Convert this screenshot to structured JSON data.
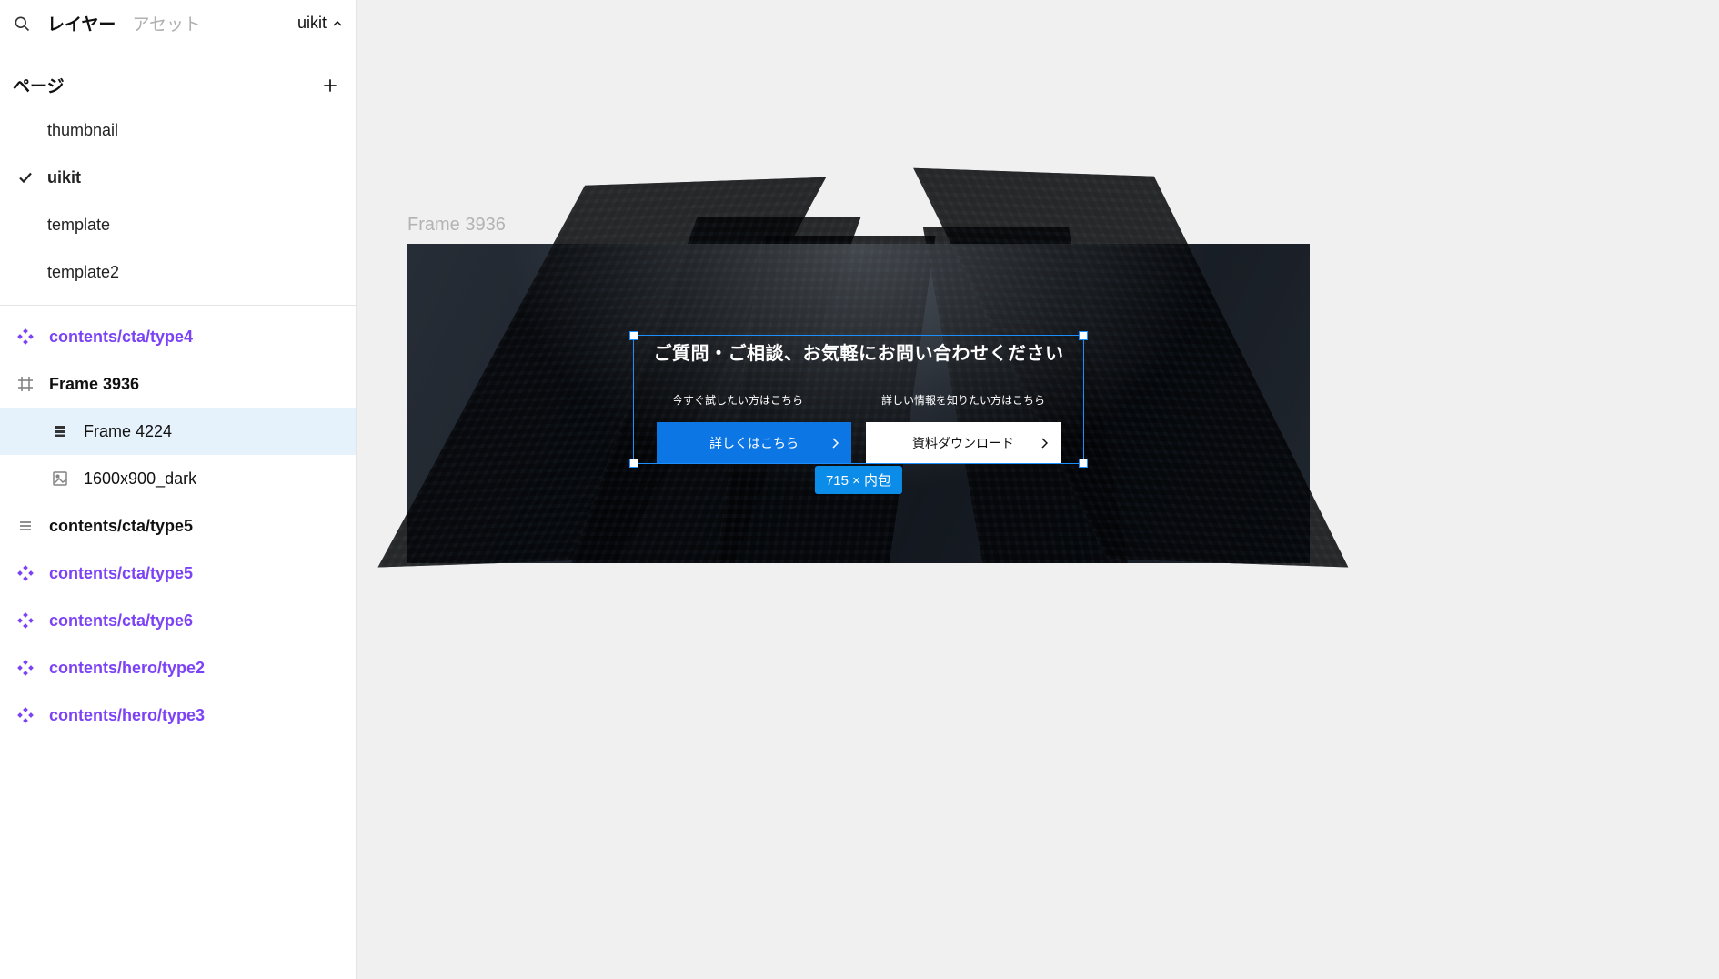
{
  "tabs": {
    "layers": "レイヤー",
    "assets": "アセット"
  },
  "project": {
    "name": "uikit"
  },
  "pagesSection": {
    "title": "ページ"
  },
  "pages": [
    {
      "name": "thumbnail",
      "current": false
    },
    {
      "name": "uikit",
      "current": true
    },
    {
      "name": "template",
      "current": false
    },
    {
      "name": "template2",
      "current": false
    }
  ],
  "layers": [
    {
      "icon": "component",
      "label": "contents/cta/type4",
      "style": "component",
      "indent": 0
    },
    {
      "icon": "frame",
      "label": "Frame 3936",
      "style": "bold",
      "indent": 0
    },
    {
      "icon": "vstack",
      "label": "Frame 4224",
      "style": "normal",
      "indent": 1,
      "selected": true
    },
    {
      "icon": "image",
      "label": "1600x900_dark",
      "style": "normal",
      "indent": 1
    },
    {
      "icon": "hstack",
      "label": "contents/cta/type5",
      "style": "bold",
      "indent": 0
    },
    {
      "icon": "component",
      "label": "contents/cta/type5",
      "style": "component",
      "indent": 0
    },
    {
      "icon": "component",
      "label": "contents/cta/type6",
      "style": "component",
      "indent": 0
    },
    {
      "icon": "component",
      "label": "contents/hero/type2",
      "style": "component",
      "indent": 0
    },
    {
      "icon": "component",
      "label": "contents/hero/type3",
      "style": "component",
      "indent": 0
    }
  ],
  "canvas": {
    "frameLabel": "Frame 3936",
    "cta": {
      "heading": "ご質問・ご相談、お気軽にお問い合わせください",
      "subLeft": "今すぐ試したい方はこちら",
      "subRight": "詳しい情報を知りたい方はこちら",
      "btnPrimary": "詳しくはこちら",
      "btnSecondary": "資料ダウンロード"
    },
    "dimensionTag": "715 × 内包"
  },
  "colors": {
    "selection": "#1C8FFF",
    "componentPurple": "#7B42F6",
    "btnPrimary": "#0C76E4"
  }
}
